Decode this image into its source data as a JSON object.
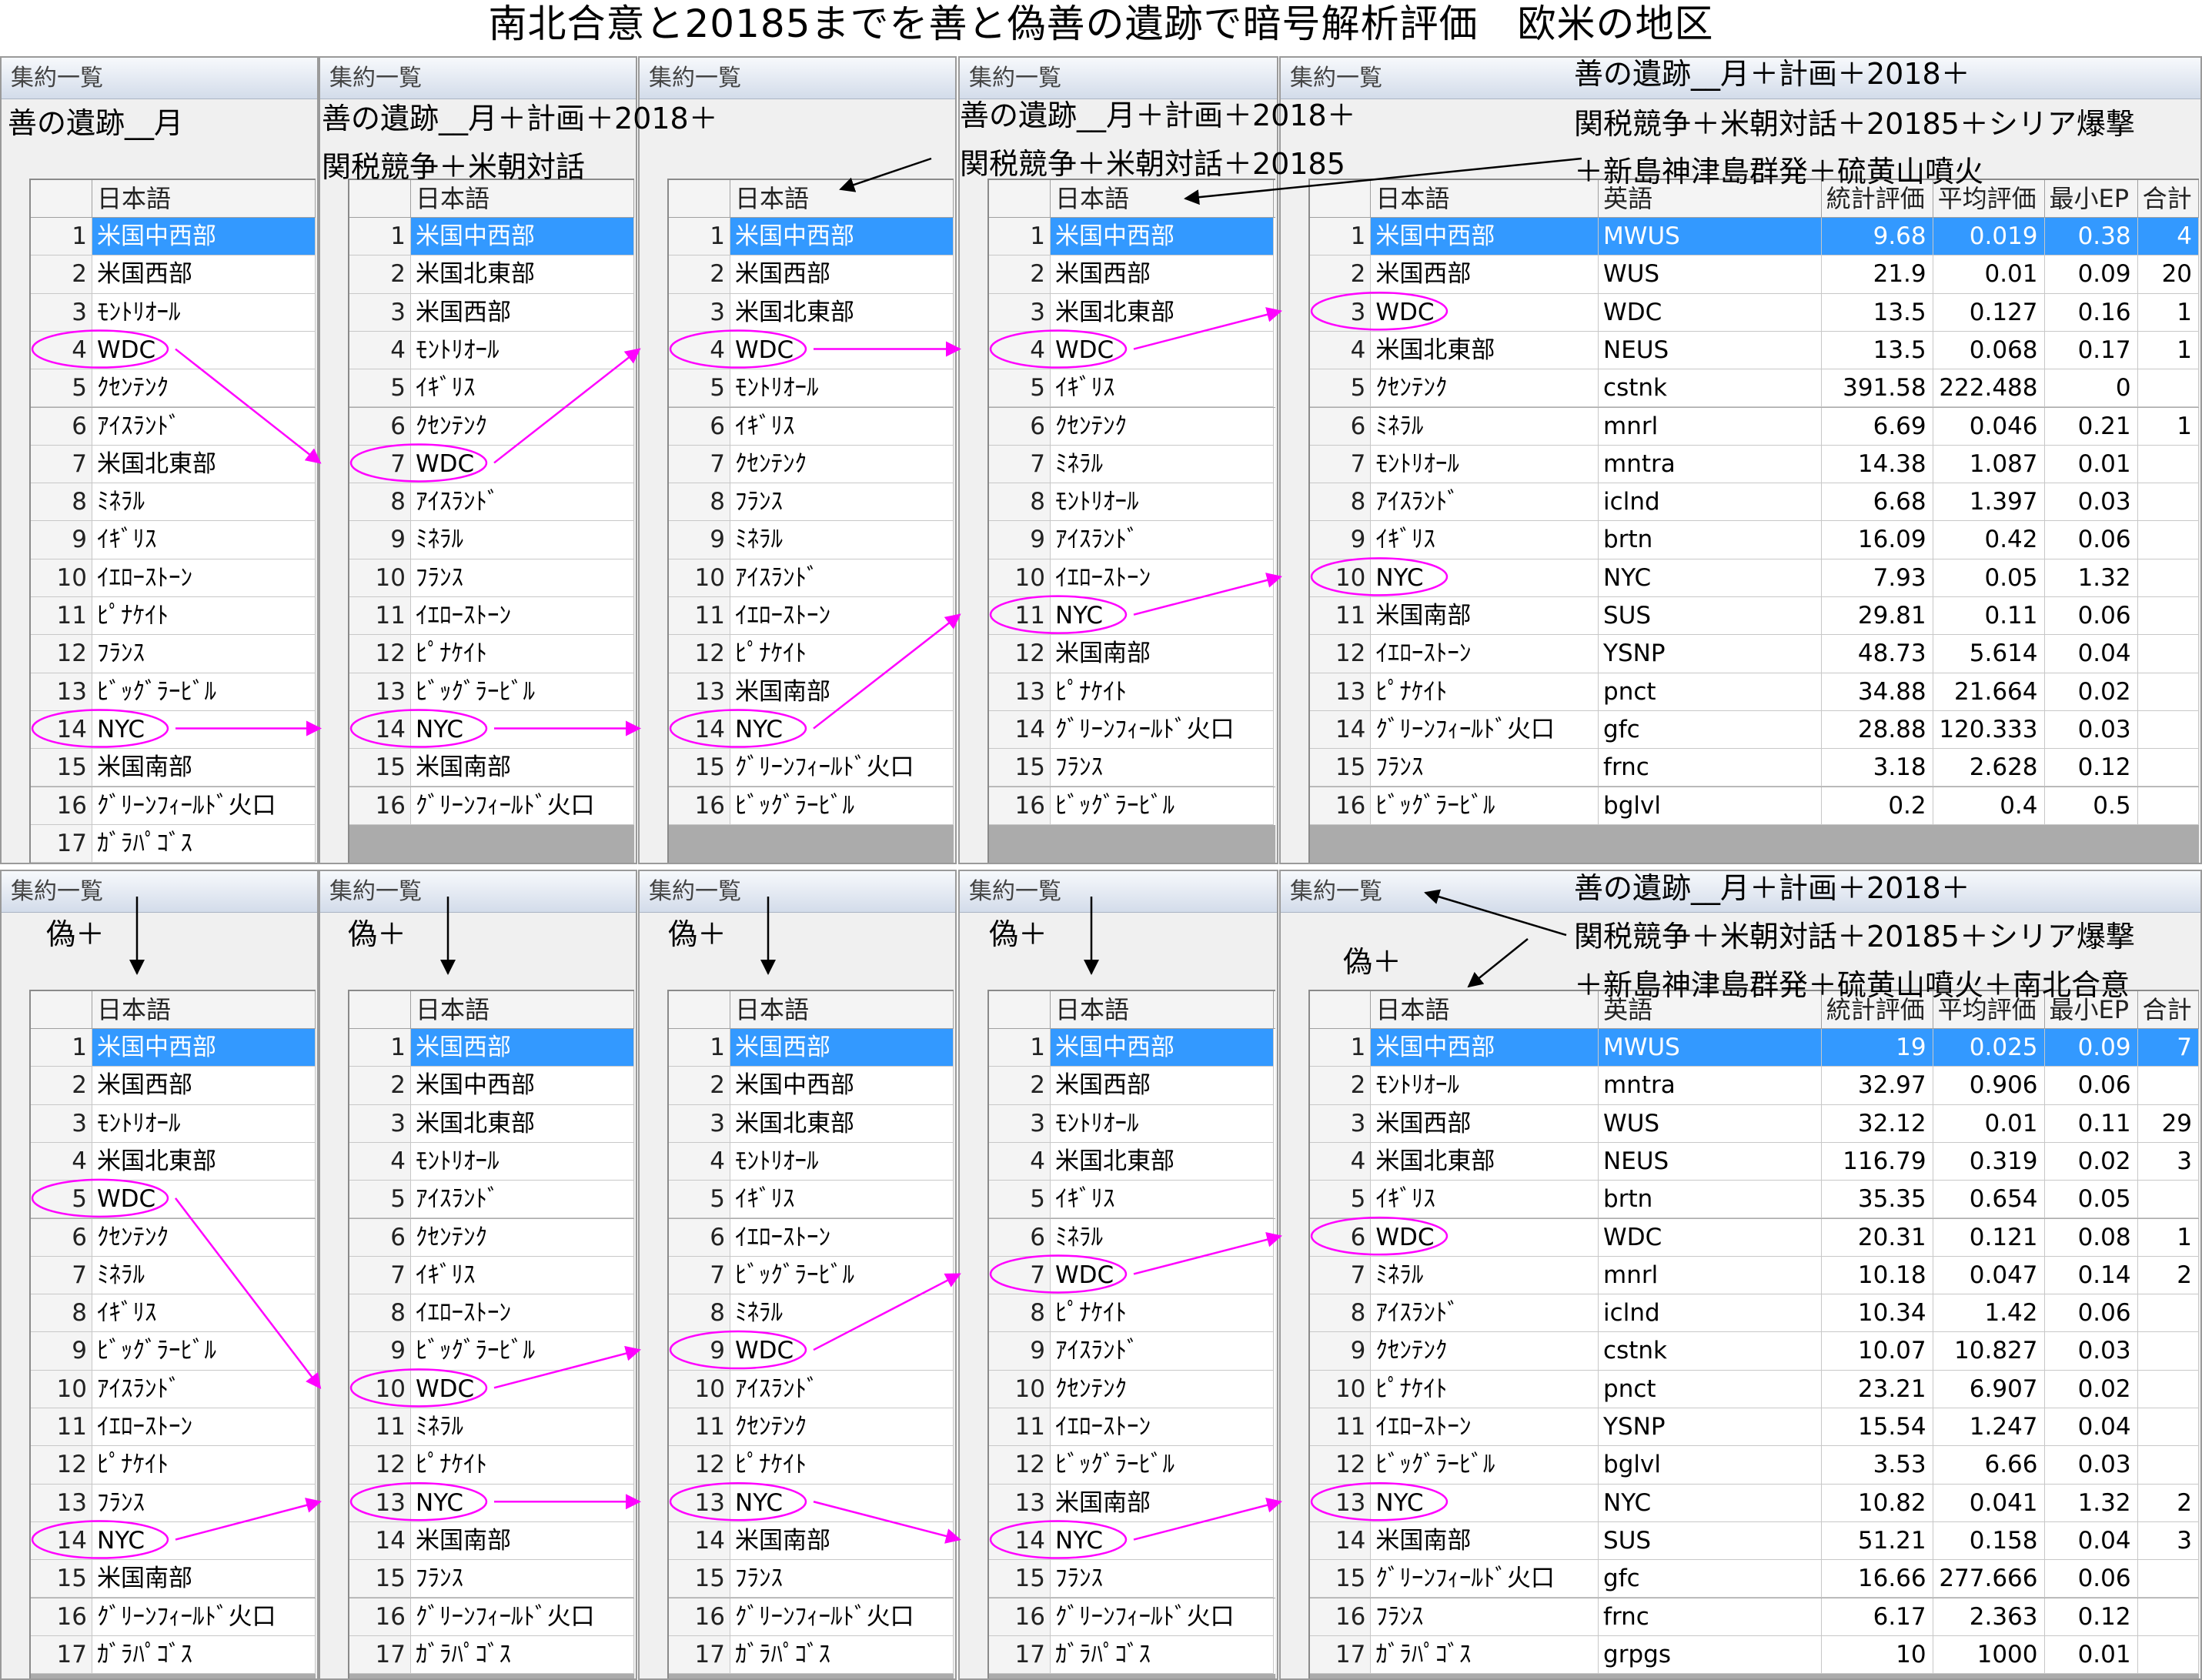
{
  "title": "南北合意と20185までを善と偽善の遺跡で暗号解析評価　欧米の地区",
  "panel_title": "集約一覧",
  "headers": {
    "num": "",
    "ja": "日本語",
    "en": "英語",
    "stat": "統計評価",
    "avg": "平均評価",
    "min": "最小EP",
    "sum": "合計"
  },
  "colors": {
    "accent": "#ff00ff",
    "selection": "#3399ff"
  },
  "annotations": {
    "p1": "善の遺跡__月",
    "p2a": "善の遺跡__月＋計画＋2018＋",
    "p2b": "関税競争＋米朝対話",
    "p3a": "善の遺跡__月＋計画＋2018＋",
    "p3b": "関税競争＋米朝対話＋20185",
    "p4a": "善の遺跡__月＋計画＋2018＋",
    "p4b": "関税競争＋米朝対話＋20185＋シリア爆撃",
    "p4c": "＋新島神津島群発＋硫黄山噴火",
    "fake": "偽＋",
    "p8a": "善の遺跡__月＋計画＋2018＋",
    "p8b": "関税競争＋米朝対話＋20185＋シリア爆撃",
    "p8c": "＋新島神津島群発＋硫黄山噴火＋南北合意"
  },
  "top": {
    "t1": [
      "米国中西部",
      "米国西部",
      "ﾓﾝﾄﾘｵｰﾙ",
      "WDC",
      "ｸｾﾝﾃﾝｸ",
      "ｱｲｽﾗﾝﾄﾞ",
      "米国北東部",
      "ﾐﾈﾗﾙ",
      "ｲｷﾞﾘｽ",
      "ｲｴﾛｰｽﾄｰﾝ",
      "ﾋﾟﾅｹｲﾄ",
      "ﾌﾗﾝｽ",
      "ﾋﾞｯｸﾞﾗｰﾋﾞﾙ",
      "NYC",
      "米国南部",
      "ｸﾞﾘｰﾝﾌｨｰﾙﾄﾞ火口",
      "ｶﾞﾗﾊﾟｺﾞｽ"
    ],
    "t2": [
      "米国中西部",
      "米国北東部",
      "米国西部",
      "ﾓﾝﾄﾘｵｰﾙ",
      "ｲｷﾞﾘｽ",
      "ｸｾﾝﾃﾝｸ",
      "WDC",
      "ｱｲｽﾗﾝﾄﾞ",
      "ﾐﾈﾗﾙ",
      "ﾌﾗﾝｽ",
      "ｲｴﾛｰｽﾄｰﾝ",
      "ﾋﾟﾅｹｲﾄ",
      "ﾋﾞｯｸﾞﾗｰﾋﾞﾙ",
      "NYC",
      "米国南部",
      "ｸﾞﾘｰﾝﾌｨｰﾙﾄﾞ火口"
    ],
    "t3": [
      "米国中西部",
      "米国西部",
      "米国北東部",
      "WDC",
      "ﾓﾝﾄﾘｵｰﾙ",
      "ｲｷﾞﾘｽ",
      "ｸｾﾝﾃﾝｸ",
      "ﾌﾗﾝｽ",
      "ﾐﾈﾗﾙ",
      "ｱｲｽﾗﾝﾄﾞ",
      "ｲｴﾛｰｽﾄｰﾝ",
      "ﾋﾟﾅｹｲﾄ",
      "米国南部",
      "NYC",
      "ｸﾞﾘｰﾝﾌｨｰﾙﾄﾞ火口",
      "ﾋﾞｯｸﾞﾗｰﾋﾞﾙ"
    ],
    "t4": [
      "米国中西部",
      "米国西部",
      "米国北東部",
      "WDC",
      "ｲｷﾞﾘｽ",
      "ｸｾﾝﾃﾝｸ",
      "ﾐﾈﾗﾙ",
      "ﾓﾝﾄﾘｵｰﾙ",
      "ｱｲｽﾗﾝﾄﾞ",
      "ｲｴﾛｰｽﾄｰﾝ",
      "NYC",
      "米国南部",
      "ﾋﾟﾅｹｲﾄ",
      "ｸﾞﾘｰﾝﾌｨｰﾙﾄﾞ火口",
      "ﾌﾗﾝｽ",
      "ﾋﾞｯｸﾞﾗｰﾋﾞﾙ"
    ],
    "t5": [
      [
        "米国中西部",
        "MWUS",
        "9.68",
        "0.019",
        "0.38",
        "4"
      ],
      [
        "米国西部",
        "WUS",
        "21.9",
        "0.01",
        "0.09",
        "20"
      ],
      [
        "WDC",
        "WDC",
        "13.5",
        "0.127",
        "0.16",
        "1"
      ],
      [
        "米国北東部",
        "NEUS",
        "13.5",
        "0.068",
        "0.17",
        "1"
      ],
      [
        "ｸｾﾝﾃﾝｸ",
        "cstnk",
        "391.58",
        "222.488",
        "0",
        ""
      ],
      [
        "ﾐﾈﾗﾙ",
        "mnrl",
        "6.69",
        "0.046",
        "0.21",
        "1"
      ],
      [
        "ﾓﾝﾄﾘｵｰﾙ",
        "mntra",
        "14.38",
        "1.087",
        "0.01",
        ""
      ],
      [
        "ｱｲｽﾗﾝﾄﾞ",
        "iclnd",
        "6.68",
        "1.397",
        "0.03",
        ""
      ],
      [
        "ｲｷﾞﾘｽ",
        "brtn",
        "16.09",
        "0.42",
        "0.06",
        ""
      ],
      [
        "NYC",
        "NYC",
        "7.93",
        "0.05",
        "1.32",
        ""
      ],
      [
        "米国南部",
        "SUS",
        "29.81",
        "0.11",
        "0.06",
        ""
      ],
      [
        "ｲｴﾛｰｽﾄｰﾝ",
        "YSNP",
        "48.73",
        "5.614",
        "0.04",
        ""
      ],
      [
        "ﾋﾟﾅｹｲﾄ",
        "pnct",
        "34.88",
        "21.664",
        "0.02",
        ""
      ],
      [
        "ｸﾞﾘｰﾝﾌｨｰﾙﾄﾞ火口",
        "gfc",
        "28.88",
        "120.333",
        "0.03",
        ""
      ],
      [
        "ﾌﾗﾝｽ",
        "frnc",
        "3.18",
        "2.628",
        "0.12",
        ""
      ],
      [
        "ﾋﾞｯｸﾞﾗｰﾋﾞﾙ",
        "bglvl",
        "0.2",
        "0.4",
        "0.5",
        ""
      ]
    ]
  },
  "bottom": {
    "b1": [
      "米国中西部",
      "米国西部",
      "ﾓﾝﾄﾘｵｰﾙ",
      "米国北東部",
      "WDC",
      "ｸｾﾝﾃﾝｸ",
      "ﾐﾈﾗﾙ",
      "ｲｷﾞﾘｽ",
      "ﾋﾞｯｸﾞﾗｰﾋﾞﾙ",
      "ｱｲｽﾗﾝﾄﾞ",
      "ｲｴﾛｰｽﾄｰﾝ",
      "ﾋﾟﾅｹｲﾄ",
      "ﾌﾗﾝｽ",
      "NYC",
      "米国南部",
      "ｸﾞﾘｰﾝﾌｨｰﾙﾄﾞ火口",
      "ｶﾞﾗﾊﾟｺﾞｽ"
    ],
    "b2": [
      "米国西部",
      "米国中西部",
      "米国北東部",
      "ﾓﾝﾄﾘｵｰﾙ",
      "ｱｲｽﾗﾝﾄﾞ",
      "ｸｾﾝﾃﾝｸ",
      "ｲｷﾞﾘｽ",
      "ｲｴﾛｰｽﾄｰﾝ",
      "ﾋﾞｯｸﾞﾗｰﾋﾞﾙ",
      "WDC",
      "ﾐﾈﾗﾙ",
      "ﾋﾟﾅｹｲﾄ",
      "NYC",
      "米国南部",
      "ﾌﾗﾝｽ",
      "ｸﾞﾘｰﾝﾌｨｰﾙﾄﾞ火口",
      "ｶﾞﾗﾊﾟｺﾞｽ"
    ],
    "b3": [
      "米国西部",
      "米国中西部",
      "米国北東部",
      "ﾓﾝﾄﾘｵｰﾙ",
      "ｲｷﾞﾘｽ",
      "ｲｴﾛｰｽﾄｰﾝ",
      "ﾋﾞｯｸﾞﾗｰﾋﾞﾙ",
      "ﾐﾈﾗﾙ",
      "WDC",
      "ｱｲｽﾗﾝﾄﾞ",
      "ｸｾﾝﾃﾝｸ",
      "ﾋﾟﾅｹｲﾄ",
      "NYC",
      "米国南部",
      "ﾌﾗﾝｽ",
      "ｸﾞﾘｰﾝﾌｨｰﾙﾄﾞ火口",
      "ｶﾞﾗﾊﾟｺﾞｽ"
    ],
    "b4": [
      "米国中西部",
      "米国西部",
      "ﾓﾝﾄﾘｵｰﾙ",
      "米国北東部",
      "ｲｷﾞﾘｽ",
      "ﾐﾈﾗﾙ",
      "WDC",
      "ﾋﾟﾅｹｲﾄ",
      "ｱｲｽﾗﾝﾄﾞ",
      "ｸｾﾝﾃﾝｸ",
      "ｲｴﾛｰｽﾄｰﾝ",
      "ﾋﾞｯｸﾞﾗｰﾋﾞﾙ",
      "米国南部",
      "NYC",
      "ﾌﾗﾝｽ",
      "ｸﾞﾘｰﾝﾌｨｰﾙﾄﾞ火口",
      "ｶﾞﾗﾊﾟｺﾞｽ"
    ],
    "b5": [
      [
        "米国中西部",
        "MWUS",
        "19",
        "0.025",
        "0.09",
        "7"
      ],
      [
        "ﾓﾝﾄﾘｵｰﾙ",
        "mntra",
        "32.97",
        "0.906",
        "0.06",
        ""
      ],
      [
        "米国西部",
        "WUS",
        "32.12",
        "0.01",
        "0.11",
        "29"
      ],
      [
        "米国北東部",
        "NEUS",
        "116.79",
        "0.319",
        "0.02",
        "3"
      ],
      [
        "ｲｷﾞﾘｽ",
        "brtn",
        "35.35",
        "0.654",
        "0.05",
        ""
      ],
      [
        "WDC",
        "WDC",
        "20.31",
        "0.121",
        "0.08",
        "1"
      ],
      [
        "ﾐﾈﾗﾙ",
        "mnrl",
        "10.18",
        "0.047",
        "0.14",
        "2"
      ],
      [
        "ｱｲｽﾗﾝﾄﾞ",
        "iclnd",
        "10.34",
        "1.42",
        "0.06",
        ""
      ],
      [
        "ｸｾﾝﾃﾝｸ",
        "cstnk",
        "10.07",
        "10.827",
        "0.03",
        ""
      ],
      [
        "ﾋﾟﾅｹｲﾄ",
        "pnct",
        "23.21",
        "6.907",
        "0.02",
        ""
      ],
      [
        "ｲｴﾛｰｽﾄｰﾝ",
        "YSNP",
        "15.54",
        "1.247",
        "0.04",
        ""
      ],
      [
        "ﾋﾞｯｸﾞﾗｰﾋﾞﾙ",
        "bglvl",
        "3.53",
        "6.66",
        "0.03",
        ""
      ],
      [
        "NYC",
        "NYC",
        "10.82",
        "0.041",
        "1.32",
        "2"
      ],
      [
        "米国南部",
        "SUS",
        "51.21",
        "0.158",
        "0.04",
        "3"
      ],
      [
        "ｸﾞﾘｰﾝﾌｨｰﾙﾄﾞ火口",
        "gfc",
        "16.66",
        "277.666",
        "0.06",
        ""
      ],
      [
        "ﾌﾗﾝｽ",
        "frnc",
        "6.17",
        "2.363",
        "0.12",
        ""
      ],
      [
        "ｶﾞﾗﾊﾟｺﾞｽ",
        "grpgs",
        "10",
        "1000",
        "0.01",
        ""
      ]
    ]
  }
}
